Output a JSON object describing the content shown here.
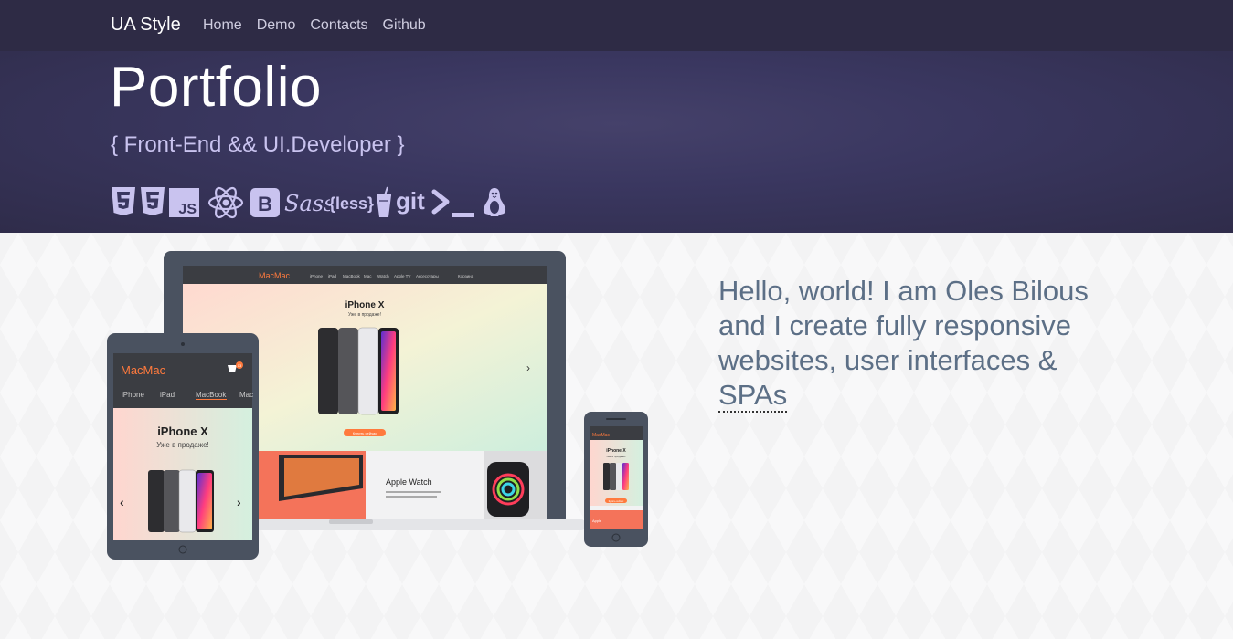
{
  "navbar": {
    "brand": "UA Style",
    "links": [
      "Home",
      "Demo",
      "Contacts",
      "Github"
    ]
  },
  "hero": {
    "title": "Portfolio",
    "subtitle": "{ Front-End && UI.Developer }",
    "tech_icons": [
      "html5-icon",
      "css3-icon",
      "javascript-icon",
      "react-icon",
      "bootstrap-icon",
      "sass-icon",
      "less-icon",
      "gulp-icon",
      "git-icon",
      "terminal-icon",
      "linux-icon"
    ],
    "icon_labels": {
      "js": "JS",
      "bootstrap": "B",
      "sass": "Sass",
      "less": "{less}",
      "git": "git"
    }
  },
  "intro": {
    "text_before": "Hello, world! I am Oles Bilous and I create fully responsive websites, user interfaces & ",
    "abbr": "SPAs"
  },
  "mockup": {
    "laptop": {
      "logo": "MacMac",
      "menu": [
        "iPhone",
        "iPad",
        "MacBook",
        "Mac",
        "Watch",
        "Apple TV",
        "Аксессуары"
      ],
      "cart": "Корзина",
      "hero_title": "iPhone X",
      "hero_sub": "Уже в продаже!",
      "cta": "Купить сейчас",
      "next": "›",
      "product": "Apple Watch",
      "product_text": "Самые совершенные часы. Выбирайте различные стили и модели часов."
    },
    "tablet": {
      "logo": "MacMac",
      "badge": "13",
      "menu": [
        "iPhone",
        "iPad",
        "MacBook",
        "Mac"
      ],
      "hero_title": "iPhone X",
      "hero_sub": "Уже в продаже!",
      "prev": "‹",
      "next": "›"
    },
    "phone": {
      "logo": "MacMac",
      "hero_title": "iPhone X",
      "hero_sub": "Уже в продаже!",
      "cta": "Купить сейчас",
      "product": "Apple"
    }
  },
  "colors": {
    "navbar": "#2e2b45",
    "hero": "#3a3760",
    "icon_fill": "#c9c3ef",
    "intro_text": "#5c6f86",
    "device_frame": "#4a5260",
    "mockup_accent": "#ff7a3d"
  }
}
